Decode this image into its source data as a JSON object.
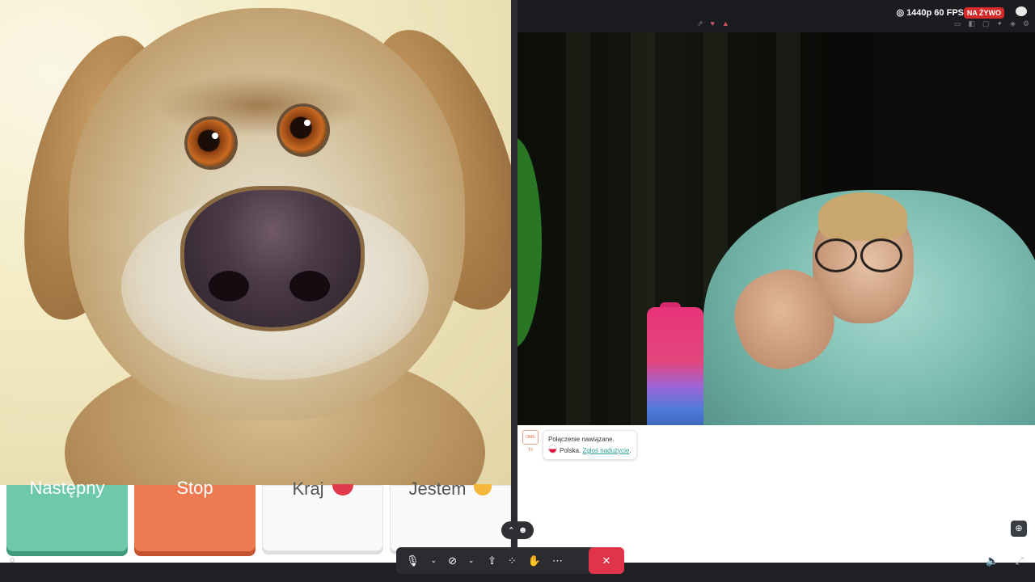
{
  "stream": {
    "quality": "1440p 60 FPS",
    "live_badge": "NA ŻYWO"
  },
  "chat": {
    "logo_text": "OME TV",
    "message_line1": "Połączenie nawiązane.",
    "country": "Polska.",
    "report_link": "Zgłoś nadużycie",
    "report_suffix": "."
  },
  "buttons": {
    "next": "Następny",
    "stop": "Stop",
    "country": "Kraj",
    "iam": "Jestem"
  },
  "toolbar": {
    "mic_icon": "microphone-icon",
    "camera_icon": "camera-off-icon",
    "share_icon": "share-screen-icon",
    "apps_icon": "apps-icon",
    "reactions_icon": "raise-hand-icon",
    "more_icon": "more-icon",
    "end_icon": "end-call-icon"
  },
  "colors": {
    "next": "#6dc9a8",
    "stop": "#ee7a51",
    "end_call": "#e0344a",
    "live": "#d42a2a",
    "link": "#2b9d8f"
  }
}
